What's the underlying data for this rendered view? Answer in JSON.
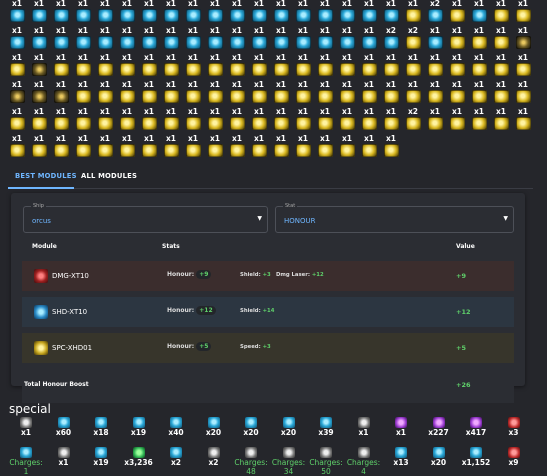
{
  "module_grid": {
    "rows": [
      {
        "count": "x1",
        "icons": [
          "b",
          "b",
          "b",
          "b",
          "b",
          "b",
          "b",
          "b",
          "b",
          "b",
          "b",
          "b",
          "b",
          "b",
          "b",
          "b",
          "b",
          "b",
          "y",
          "b",
          "y",
          "b",
          "y",
          "y"
        ],
        "counts": [
          "x1",
          "x1",
          "x1",
          "x1",
          "x1",
          "x1",
          "x1",
          "x1",
          "x1",
          "x1",
          "x1",
          "x1",
          "x1",
          "x1",
          "x1",
          "x1",
          "x1",
          "x1",
          "x1",
          "x2",
          "x1",
          "x1",
          "x1",
          "x1"
        ]
      },
      {
        "icons": [
          "b",
          "b",
          "b",
          "b",
          "b",
          "b",
          "b",
          "b",
          "b",
          "b",
          "b",
          "b",
          "b",
          "b",
          "b",
          "b",
          "b",
          "b",
          "y",
          "b",
          "y",
          "y",
          "y",
          "d"
        ],
        "counts": [
          "x1",
          "x1",
          "x1",
          "x1",
          "x1",
          "x1",
          "x1",
          "x1",
          "x1",
          "x1",
          "x1",
          "x1",
          "x1",
          "x1",
          "x1",
          "x1",
          "x1",
          "x2",
          "x2",
          "x1",
          "x1",
          "x1",
          "x1",
          "x1"
        ]
      },
      {
        "icons": [
          "y",
          "d",
          "y",
          "y",
          "y",
          "y",
          "y",
          "y",
          "y",
          "y",
          "y",
          "y",
          "y",
          "y",
          "y",
          "y",
          "y",
          "y",
          "y",
          "y",
          "y",
          "y",
          "y",
          "y"
        ],
        "counts": [
          "x1",
          "x1",
          "x1",
          "x1",
          "x1",
          "x1",
          "x1",
          "x1",
          "x1",
          "x1",
          "x1",
          "x1",
          "x1",
          "x1",
          "x1",
          "x1",
          "x1",
          "x1",
          "x1",
          "x1",
          "x1",
          "x1",
          "x1",
          "x1"
        ]
      },
      {
        "icons": [
          "d",
          "d",
          "d",
          "y",
          "y",
          "y",
          "y",
          "y",
          "y",
          "y",
          "y",
          "y",
          "y",
          "y",
          "y",
          "y",
          "y",
          "y",
          "y",
          "y",
          "y",
          "y",
          "y",
          "y"
        ],
        "counts": [
          "x1",
          "x1",
          "x1",
          "x1",
          "x1",
          "x1",
          "x1",
          "x1",
          "x1",
          "x1",
          "x1",
          "x1",
          "x1",
          "x1",
          "x1",
          "x1",
          "x1",
          "x1",
          "x1",
          "x1",
          "x1",
          "x1",
          "x1",
          "x1"
        ]
      },
      {
        "icons": [
          "y",
          "y",
          "y",
          "y",
          "y",
          "y",
          "y",
          "y",
          "y",
          "y",
          "y",
          "y",
          "y",
          "y",
          "y",
          "y",
          "y",
          "y",
          "y",
          "y",
          "y",
          "y",
          "y",
          "y"
        ],
        "counts": [
          "x1",
          "x1",
          "x1",
          "x1",
          "x1",
          "x1",
          "x1",
          "x1",
          "x1",
          "x1",
          "x1",
          "x1",
          "x1",
          "x1",
          "x1",
          "x1",
          "x1",
          "x1",
          "x2",
          "x1",
          "x1",
          "x1",
          "x1",
          "x1"
        ]
      },
      {
        "icons": [
          "y",
          "y",
          "y",
          "y",
          "y",
          "y",
          "y",
          "y",
          "y",
          "y",
          "y",
          "y",
          "y",
          "y",
          "y",
          "y",
          "y",
          "y"
        ],
        "counts": [
          "x1",
          "x1",
          "x1",
          "x1",
          "x1",
          "x1",
          "x1",
          "x1",
          "x1",
          "x1",
          "x1",
          "x1",
          "x1",
          "x1",
          "x1",
          "x1",
          "x1",
          "x1"
        ]
      }
    ]
  },
  "tabs": {
    "best": "BEST MODULES",
    "all": "ALL MODULES"
  },
  "ship_select": {
    "label": "Ship",
    "value": "orcus"
  },
  "stat_select": {
    "label": "Stat",
    "value": "HONOUR"
  },
  "table": {
    "headers": {
      "module": "Module",
      "stats": "Stats",
      "value": "Value"
    },
    "rows": [
      {
        "name": "DMG-XT10",
        "honour_label": "Honour:",
        "honour": "+9",
        "s2_label": "Shield:",
        "s2": "+3",
        "s3_label": "Dmg Laser:",
        "s3": "+12",
        "value": "+9"
      },
      {
        "name": "SHD-XT10",
        "honour_label": "Honour:",
        "honour": "+12",
        "s2_label": "Shield:",
        "s2": "+14",
        "s3_label": "",
        "s3": "",
        "value": "+12"
      },
      {
        "name": "SPC-XHD01",
        "honour_label": "Honour:",
        "honour": "+5",
        "s2_label": "Speed:",
        "s2": "+3",
        "s3_label": "",
        "s3": "",
        "value": "+5"
      }
    ],
    "total_label": "Total Honour Boost",
    "total_value": "+26"
  },
  "special": {
    "title": "special",
    "row1": [
      {
        "icon": "g",
        "count": "x1"
      },
      {
        "icon": "b",
        "count": "x60"
      },
      {
        "icon": "b",
        "count": "x18"
      },
      {
        "icon": "b",
        "count": "x19"
      },
      {
        "icon": "b",
        "count": "x40"
      },
      {
        "icon": "b",
        "count": "x20"
      },
      {
        "icon": "b",
        "count": "x20"
      },
      {
        "icon": "b",
        "count": "x20"
      },
      {
        "icon": "b",
        "count": "x39"
      },
      {
        "icon": "g",
        "count": "x1"
      },
      {
        "icon": "p",
        "count": "x1"
      },
      {
        "icon": "p",
        "count": "x227"
      },
      {
        "icon": "p",
        "count": "x417"
      },
      {
        "icon": "r",
        "count": "x3"
      }
    ],
    "row2": [
      {
        "icon": "b",
        "count": "Charges: 1",
        "green": true
      },
      {
        "icon": "g",
        "count": "x1"
      },
      {
        "icon": "b",
        "count": "x19"
      },
      {
        "icon": "gr",
        "count": "x3,236"
      },
      {
        "icon": "b",
        "count": "x2"
      },
      {
        "icon": "g",
        "count": "x2"
      },
      {
        "icon": "g",
        "count": "Charges: 48",
        "green": true
      },
      {
        "icon": "g",
        "count": "Charges: 34",
        "green": true
      },
      {
        "icon": "g",
        "count": "Charges: 50",
        "green": true
      },
      {
        "icon": "g",
        "count": "Charges: 4",
        "green": true
      },
      {
        "icon": "b",
        "count": "x13"
      },
      {
        "icon": "b",
        "count": "x20"
      },
      {
        "icon": "b",
        "count": "x1,152"
      },
      {
        "icon": "r",
        "count": "x9"
      }
    ]
  }
}
